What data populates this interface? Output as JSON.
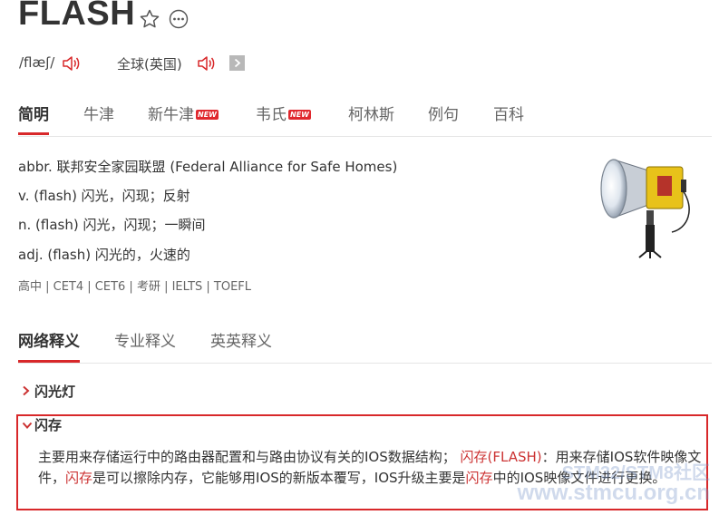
{
  "word": "FLASH",
  "phonetics": [
    {
      "text": "/flæʃ/",
      "label": ""
    },
    {
      "text": "",
      "label": "全球(英国)"
    }
  ],
  "tabs": [
    {
      "label": "简明",
      "badge": ""
    },
    {
      "label": "牛津",
      "badge": ""
    },
    {
      "label": "新牛津",
      "badge": "NEW"
    },
    {
      "label": "韦氏",
      "badge": "NEW"
    },
    {
      "label": "柯林斯",
      "badge": ""
    },
    {
      "label": "例句",
      "badge": ""
    },
    {
      "label": "百科",
      "badge": ""
    }
  ],
  "definitions": [
    "abbr. 联邦安全家园联盟 (Federal Alliance for Safe Homes)",
    "v. (flash) 闪光，闪现；反射",
    "n. (flash) 闪光，闪现；一瞬间",
    "adj. (flash) 闪光的，火速的"
  ],
  "exams": "高中 | CET4 | CET6 | 考研 | IELTS | TOEFL",
  "sub_tabs": [
    "网络释义",
    "专业释义",
    "英英释义"
  ],
  "entries": [
    {
      "title": "闪光灯"
    },
    {
      "title": "闪存"
    }
  ],
  "paragraph": {
    "p1": "主要用来存储运行中的路由器配置和与路由协议有关的IOS数据结构； ",
    "r1": "闪存(FLASH)",
    "p2": "：用来存储IOS软件映像文件，",
    "r2": "闪存",
    "p3": "是可以擦除内存，它能够用IOS的新版本覆写，IOS升级主要是",
    "r3": "闪存",
    "p4": "中的IOS映像文件进行更换。"
  },
  "watermark": {
    "line1": "STM32/STM8社区",
    "line2": "www.stmcu.org.cn"
  },
  "colors": {
    "accent": "#d8282a",
    "link_red": "#cc3333",
    "text": "#333333"
  },
  "icons": [
    "star-icon",
    "more-icon",
    "speaker-icon",
    "play-icon",
    "chevron-right-icon",
    "chevron-down-icon"
  ]
}
